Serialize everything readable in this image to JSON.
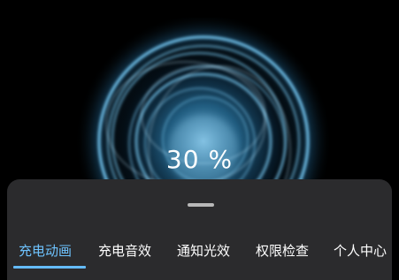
{
  "charging": {
    "percent_text": "30 %",
    "glow_color": "#5fc8ff"
  },
  "tabs": [
    {
      "label": "充电动画",
      "active": true
    },
    {
      "label": "充电音效",
      "active": false
    },
    {
      "label": "通知光效",
      "active": false
    },
    {
      "label": "权限检查",
      "active": false
    },
    {
      "label": "个人中心",
      "active": false
    }
  ],
  "colors": {
    "background": "#000000",
    "sheet": "#2b2b2d",
    "active_tab": "#6ec3ff",
    "inactive_tab": "#ffffff"
  }
}
